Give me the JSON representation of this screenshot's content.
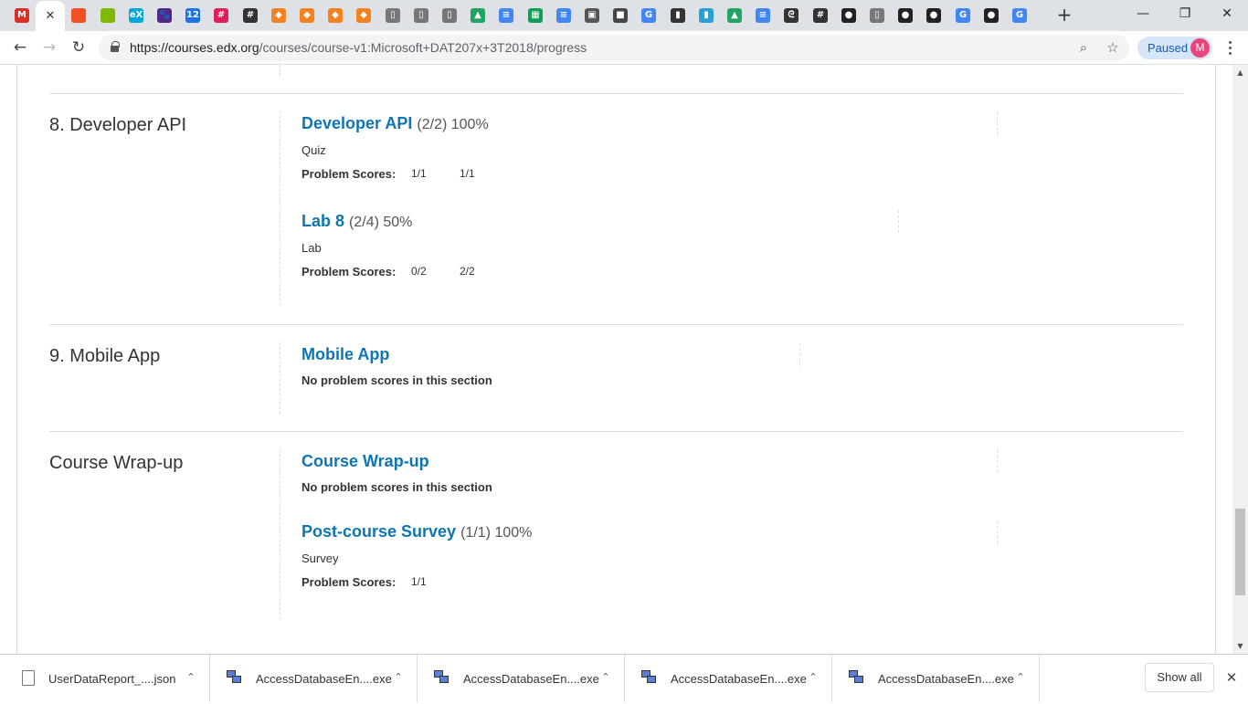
{
  "tabs": [
    {
      "icon": "gmail-icon",
      "glyph": "M",
      "color": "#d93025"
    },
    {
      "icon": "close-icon",
      "glyph": "✕",
      "color": "#333"
    },
    {
      "icon": "microsoft-icon",
      "glyph": "",
      "color": "#f25022"
    },
    {
      "icon": "microsoft-icon",
      "glyph": "",
      "color": "#7fba00"
    },
    {
      "icon": "edx-icon",
      "glyph": "eX",
      "color": "#02a6d8"
    },
    {
      "icon": "purple-cat-icon",
      "glyph": "🐾",
      "color": "#512888"
    },
    {
      "icon": "calendar-icon",
      "glyph": "12",
      "color": "#1a73e8"
    },
    {
      "icon": "slack-icon",
      "glyph": "#",
      "color": "#e01e5a"
    },
    {
      "icon": "hash-icon",
      "glyph": "#",
      "color": "#333"
    },
    {
      "icon": "orange-box-icon",
      "glyph": "◆",
      "color": "#f58220"
    },
    {
      "icon": "orange-box-icon",
      "glyph": "◆",
      "color": "#f58220"
    },
    {
      "icon": "orange-box-icon",
      "glyph": "◆",
      "color": "#f58220"
    },
    {
      "icon": "orange-box-icon",
      "glyph": "◆",
      "color": "#f58220"
    },
    {
      "icon": "document-icon",
      "glyph": "▯",
      "color": "#777"
    },
    {
      "icon": "document-icon",
      "glyph": "▯",
      "color": "#777"
    },
    {
      "icon": "document-icon",
      "glyph": "▯",
      "color": "#777"
    },
    {
      "icon": "drive-icon",
      "glyph": "▲",
      "color": "#1fa463"
    },
    {
      "icon": "docs-icon",
      "glyph": "≡",
      "color": "#4285f4"
    },
    {
      "icon": "sheets-icon",
      "glyph": "▦",
      "color": "#0f9d58"
    },
    {
      "icon": "docs-icon",
      "glyph": "≡",
      "color": "#4285f4"
    },
    {
      "icon": "puzzle-icon",
      "glyph": "▣",
      "color": "#555"
    },
    {
      "icon": "cube-icon",
      "glyph": "■",
      "color": "#444"
    },
    {
      "icon": "google-icon",
      "glyph": "G",
      "color": "#4285f4"
    },
    {
      "icon": "bar-chart-icon",
      "glyph": "▮",
      "color": "#333"
    },
    {
      "icon": "books-icon",
      "glyph": "▮",
      "color": "#2a9fd6"
    },
    {
      "icon": "drive-icon",
      "glyph": "▲",
      "color": "#1fa463"
    },
    {
      "icon": "docs-icon",
      "glyph": "≡",
      "color": "#4285f4"
    },
    {
      "icon": "swirl-icon",
      "glyph": "ᘓ",
      "color": "#333"
    },
    {
      "icon": "hash-icon",
      "glyph": "#",
      "color": "#333"
    },
    {
      "icon": "github-icon",
      "glyph": "●",
      "color": "#222"
    },
    {
      "icon": "document-icon",
      "glyph": "▯",
      "color": "#777"
    },
    {
      "icon": "github-icon",
      "glyph": "●",
      "color": "#222"
    },
    {
      "icon": "github-icon",
      "glyph": "●",
      "color": "#222"
    },
    {
      "icon": "google-icon",
      "glyph": "G",
      "color": "#4285f4"
    },
    {
      "icon": "github-icon",
      "glyph": "●",
      "color": "#222"
    },
    {
      "icon": "google-icon",
      "glyph": "G",
      "color": "#4285f4"
    }
  ],
  "window": {
    "new_tab": "+",
    "minimize": "—",
    "restore": "❐",
    "close": "✕"
  },
  "toolbar": {
    "back": "←",
    "forward": "→",
    "reload": "↻",
    "url_host": "https://courses.edx.org",
    "url_path": "/courses/course-v1:Microsoft+DAT207x+3T2018/progress",
    "zoom_icon": "⌕",
    "star_icon": "☆",
    "profile_status": "Paused",
    "avatar_letter": "M"
  },
  "chapters": [
    {
      "title": "8. Developer API",
      "sections": [
        {
          "name": "Developer API",
          "meta": "(2/2) 100%",
          "format": "Quiz",
          "scores_label": "Problem Scores:",
          "scores": [
            "1/1",
            "1/1"
          ]
        },
        {
          "name": "Lab 8",
          "meta": "(2/4) 50%",
          "format": "Lab",
          "scores_label": "Problem Scores:",
          "scores": [
            "0/2",
            "2/2"
          ]
        }
      ]
    },
    {
      "title": "9. Mobile App",
      "sections": [
        {
          "name": "Mobile App",
          "no_scores": "No problem scores in this section"
        }
      ]
    },
    {
      "title": "Course Wrap-up",
      "sections": [
        {
          "name": "Course Wrap-up",
          "no_scores": "No problem scores in this section"
        },
        {
          "name": "Post-course Survey",
          "meta": "(1/1) 100%",
          "format": "Survey",
          "scores_label": "Problem Scores:",
          "scores": [
            "1/1"
          ]
        }
      ]
    }
  ],
  "scrollbar": {
    "up": "▲",
    "down": "▼"
  },
  "downloads": [
    {
      "name": "UserDataReport_....json",
      "icon": "file-icon"
    },
    {
      "name": "AccessDatabaseEn....exe",
      "icon": "exe-icon"
    },
    {
      "name": "AccessDatabaseEn....exe",
      "icon": "exe-icon"
    },
    {
      "name": "AccessDatabaseEn....exe",
      "icon": "exe-icon"
    },
    {
      "name": "AccessDatabaseEn....exe",
      "icon": "exe-icon"
    }
  ],
  "shelf": {
    "chevron": "⌃",
    "show_all": "Show all",
    "close": "✕"
  }
}
